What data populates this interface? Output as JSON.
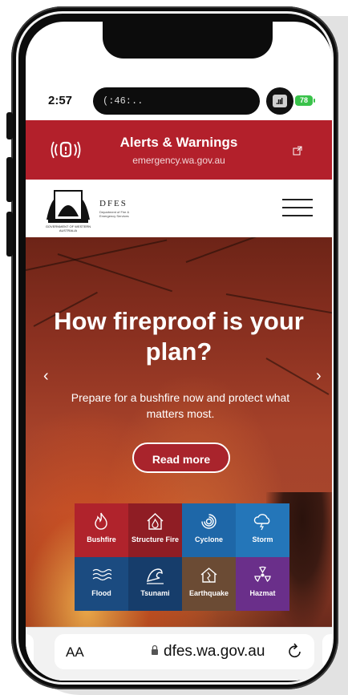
{
  "status_bar": {
    "time": "2:57",
    "island_text": "(:46:..",
    "signal": ".ııl",
    "battery": "78"
  },
  "alerts_banner": {
    "title": "Alerts & Warnings",
    "url": "emergency.wa.gov.au",
    "background_color": "#b3202b"
  },
  "header": {
    "crest_label": "GOVERNMENT OF WESTERN AUSTRALIA",
    "dfes_logo": "DFES",
    "dfes_subtitle": "Department of Fire & Emergency Services",
    "menu_icon": "hamburger-menu-icon"
  },
  "hero": {
    "title": "How fireproof is your plan?",
    "subtitle": "Prepare for a bushfire now and protect what matters most.",
    "button_label": "Read more",
    "prev_arrow": "‹",
    "next_arrow": "›"
  },
  "hazards": [
    {
      "label": "Bushfire",
      "icon": "flame-icon",
      "color": "#b0232c"
    },
    {
      "label": "Structure Fire",
      "icon": "house-fire-icon",
      "color": "#8f1d24"
    },
    {
      "label": "Cyclone",
      "icon": "cyclone-icon",
      "color": "#1e67a8"
    },
    {
      "label": "Storm",
      "icon": "storm-cloud-icon",
      "color": "#2476b9"
    },
    {
      "label": "Flood",
      "icon": "flood-waves-icon",
      "color": "#1b4b80"
    },
    {
      "label": "Tsunami",
      "icon": "tsunami-wave-icon",
      "color": "#163d6b"
    },
    {
      "label": "Earthquake",
      "icon": "earthquake-house-icon",
      "color": "#6b4b34"
    },
    {
      "label": "Hazmat",
      "icon": "hazmat-icon",
      "color": "#6a2f8a"
    }
  ],
  "browser": {
    "text_size_label": "AA",
    "url": "dfes.wa.gov.au",
    "lock_icon": "lock-icon",
    "reload_icon": "reload-icon"
  }
}
